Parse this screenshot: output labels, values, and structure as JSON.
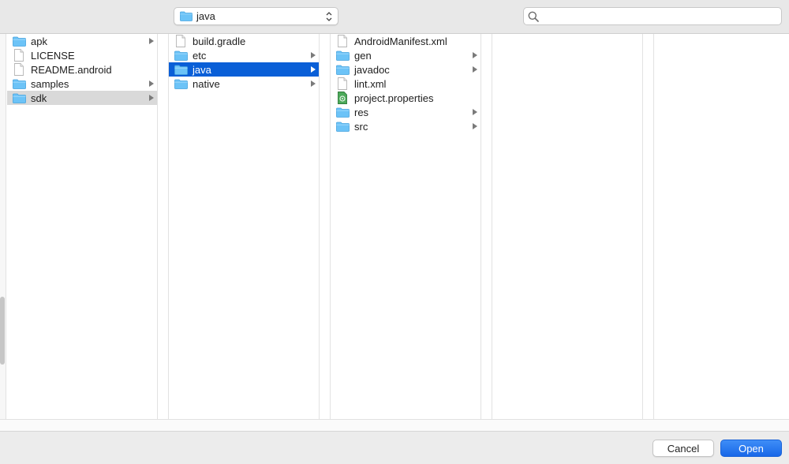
{
  "toolbar": {
    "location": "java",
    "search_value": "",
    "search_placeholder": ""
  },
  "columns": [
    {
      "items": [
        {
          "name": "apk",
          "type": "folder",
          "has_children": true,
          "selected": false
        },
        {
          "name": "LICENSE",
          "type": "file",
          "has_children": false,
          "selected": false
        },
        {
          "name": "README.android",
          "type": "file",
          "has_children": false,
          "selected": false
        },
        {
          "name": "samples",
          "type": "folder",
          "has_children": true,
          "selected": false
        },
        {
          "name": "sdk",
          "type": "folder",
          "has_children": true,
          "selected": "inactive"
        }
      ]
    },
    {
      "items": [
        {
          "name": "build.gradle",
          "type": "file",
          "has_children": false,
          "selected": false
        },
        {
          "name": "etc",
          "type": "folder",
          "has_children": true,
          "selected": false
        },
        {
          "name": "java",
          "type": "folder",
          "has_children": true,
          "selected": "active"
        },
        {
          "name": "native",
          "type": "folder",
          "has_children": true,
          "selected": false
        }
      ]
    },
    {
      "items": [
        {
          "name": "AndroidManifest.xml",
          "type": "file",
          "has_children": false,
          "selected": false
        },
        {
          "name": "gen",
          "type": "folder",
          "has_children": true,
          "selected": false
        },
        {
          "name": "javadoc",
          "type": "folder",
          "has_children": true,
          "selected": false
        },
        {
          "name": "lint.xml",
          "type": "file",
          "has_children": false,
          "selected": false
        },
        {
          "name": "project.properties",
          "type": "properties",
          "has_children": false,
          "selected": false
        },
        {
          "name": "res",
          "type": "folder",
          "has_children": true,
          "selected": false
        },
        {
          "name": "src",
          "type": "folder",
          "has_children": true,
          "selected": false
        }
      ]
    },
    {
      "items": []
    },
    {
      "items": []
    }
  ],
  "footer": {
    "cancel_label": "Cancel",
    "open_label": "Open"
  },
  "colors": {
    "folder": "#5bbcf5",
    "selection_active": "#0a5fd7",
    "selection_inactive": "#d9d9d9",
    "primary_button": "#1867e8"
  }
}
